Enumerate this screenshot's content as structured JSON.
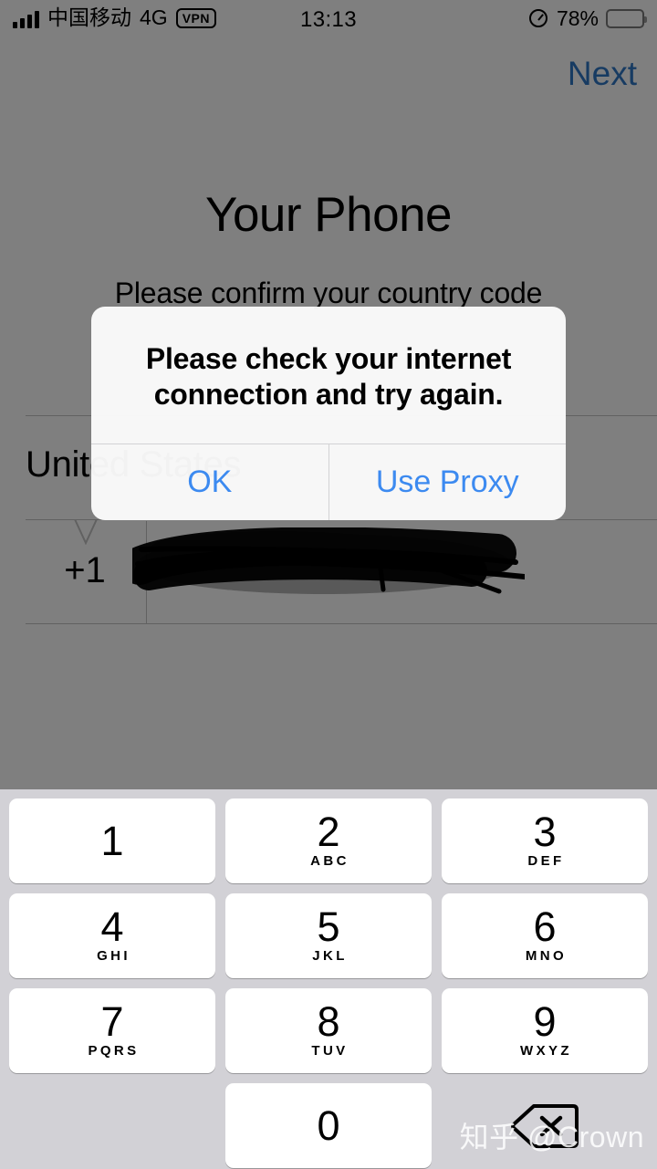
{
  "status_bar": {
    "carrier": "中国移动",
    "network": "4G",
    "vpn_badge": "VPN",
    "time": "13:13",
    "battery_percent": "78%",
    "signal_icon": "signal-bars-icon",
    "lock_icon": "rotation-lock-icon",
    "battery_icon": "battery-icon"
  },
  "nav": {
    "next_label": "Next",
    "next_color": "#2f76c4"
  },
  "screen": {
    "title": "Your Phone",
    "subtitle": "Please confirm your country code",
    "country_name": "United States",
    "country_code": "+1",
    "phone_number": "",
    "phone_number_redacted": true
  },
  "alert": {
    "message": "Please check your internet connection and try again.",
    "buttons": [
      {
        "label": "OK",
        "name": "ok-button"
      },
      {
        "label": "Use Proxy",
        "name": "use-proxy-button"
      }
    ],
    "button_color": "#3c8af0"
  },
  "keypad": {
    "rows": [
      [
        {
          "digit": "1",
          "letters": ""
        },
        {
          "digit": "2",
          "letters": "ABC"
        },
        {
          "digit": "3",
          "letters": "DEF"
        }
      ],
      [
        {
          "digit": "4",
          "letters": "GHI"
        },
        {
          "digit": "5",
          "letters": "JKL"
        },
        {
          "digit": "6",
          "letters": "MNO"
        }
      ],
      [
        {
          "digit": "7",
          "letters": "PQRS"
        },
        {
          "digit": "8",
          "letters": "TUV"
        },
        {
          "digit": "9",
          "letters": "WXYZ"
        }
      ],
      [
        {
          "digit": "",
          "letters": ""
        },
        {
          "digit": "0",
          "letters": ""
        },
        {
          "digit": "",
          "letters": "",
          "icon": "backspace-icon"
        }
      ]
    ],
    "background_color": "#d2d1d6",
    "key_color": "#ffffff"
  },
  "watermark": {
    "text": "知乎 @Crown"
  }
}
